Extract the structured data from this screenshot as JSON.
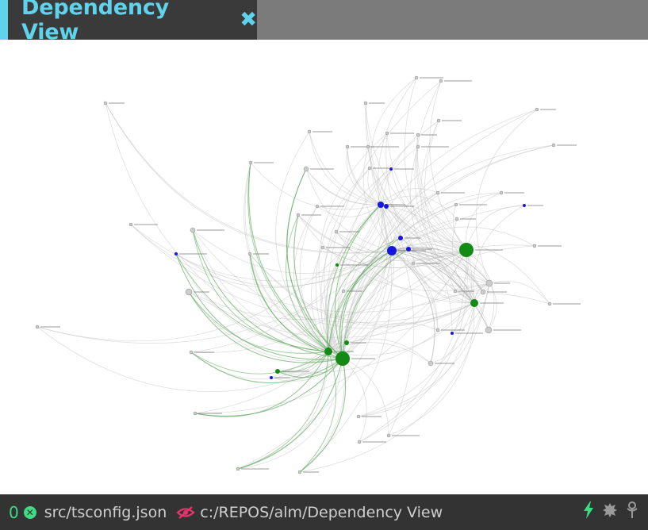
{
  "tab": {
    "title": "Dependency View",
    "close_icon": "close-x-icon",
    "accent": "#5fd3ec"
  },
  "statusbar": {
    "error_count": "0",
    "error_icon": "error-circle-icon",
    "config_file": "src/tsconfig.json",
    "visibility_icon": "eye-off-icon",
    "file_path": "c:/REPOS/alm/Dependency View",
    "right_icons": [
      "lightning-icon",
      "bug-icon",
      "tree-icon"
    ]
  },
  "graph": {
    "colors": {
      "edge": "#c4c4c4",
      "edge_highlight": "#5faa5f",
      "node_default": "#cccccc",
      "node_blue": "#1515e0",
      "node_green": "#138a13"
    }
  }
}
